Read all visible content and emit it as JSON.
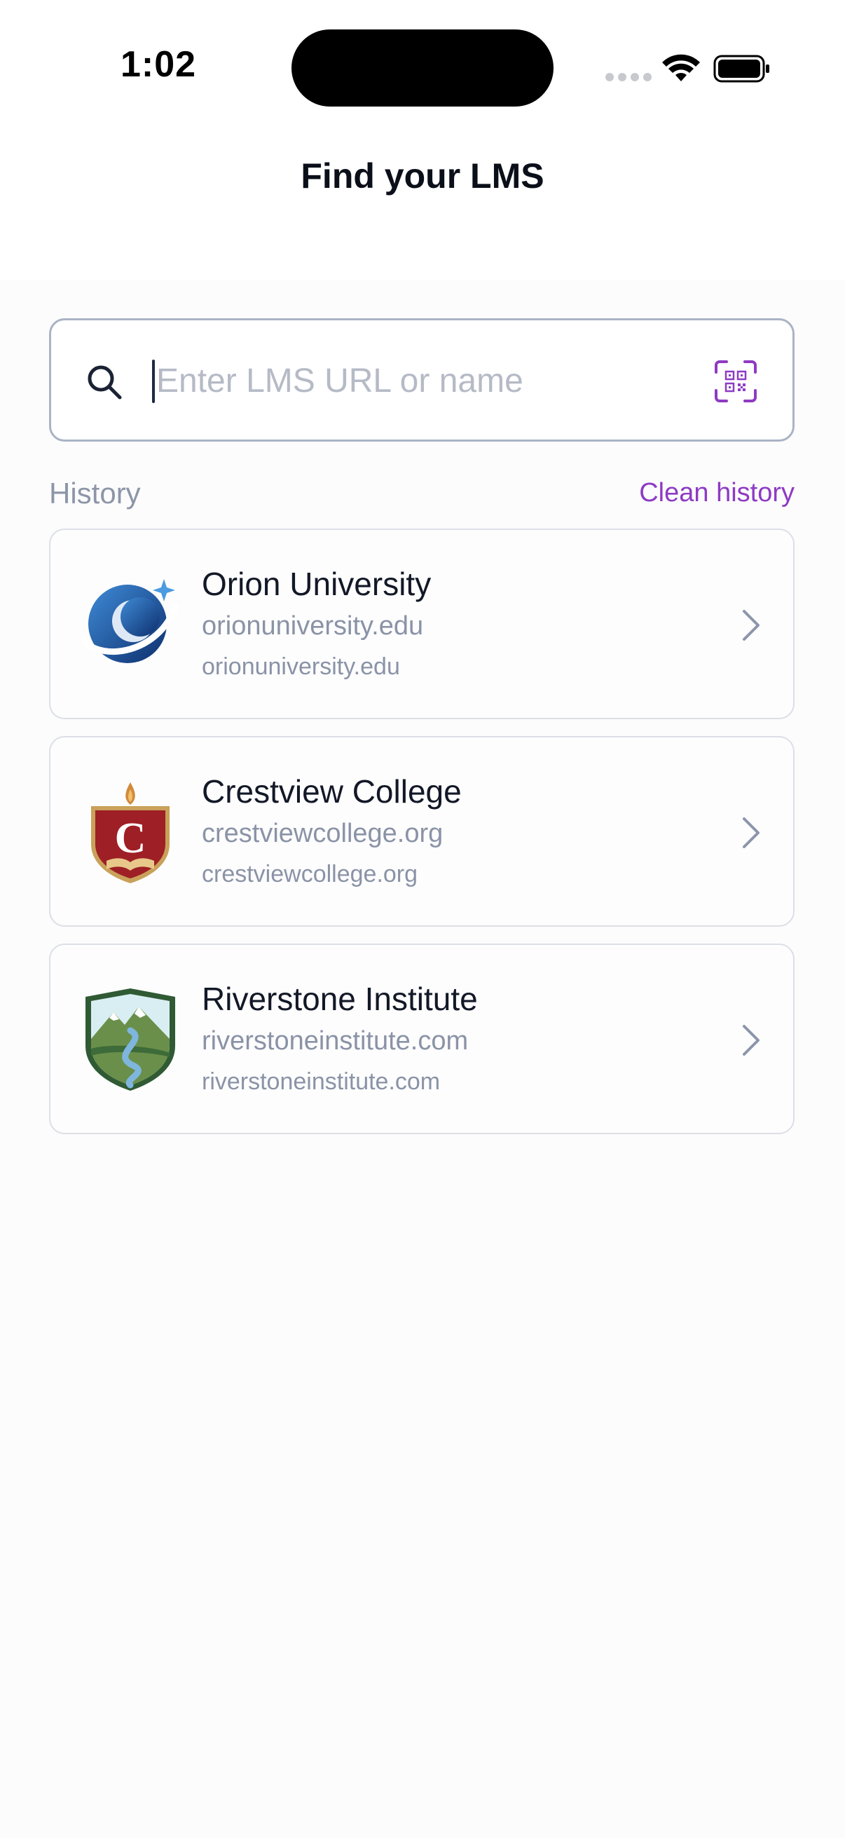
{
  "status_bar": {
    "time": "1:02"
  },
  "header": {
    "title": "Find your LMS"
  },
  "search": {
    "placeholder": "Enter LMS URL or name",
    "value": ""
  },
  "history": {
    "label": "History",
    "clean_label": "Clean history",
    "items": [
      {
        "name": "Orion University",
        "url": "orionuniversity.edu",
        "subtitle": "orionuniversity.edu",
        "logo": "orion-logo"
      },
      {
        "name": "Crestview College",
        "url": "crestviewcollege.org",
        "subtitle": "crestviewcollege.org",
        "logo": "crestview-crest",
        "logo_letter": "C"
      },
      {
        "name": "Riverstone Institute",
        "url": "riverstoneinstitute.com",
        "subtitle": "riverstoneinstitute.com",
        "logo": "riverstone-shield"
      }
    ]
  },
  "colors": {
    "accent": "#8e3bc4",
    "muted": "#8a93a6",
    "border": "#dcdfe6"
  }
}
